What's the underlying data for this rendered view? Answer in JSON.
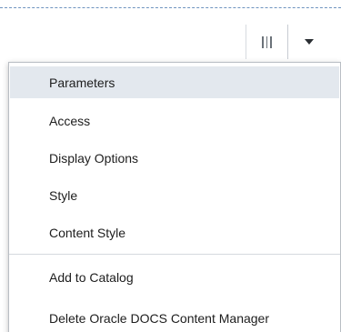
{
  "toolbar": {
    "columns_icon": "columns-icon",
    "dropdown_icon": "caret-down-icon"
  },
  "menu": {
    "items": [
      {
        "label": "Parameters",
        "highlighted": true
      },
      {
        "label": "Access"
      },
      {
        "label": "Display Options"
      },
      {
        "label": "Style"
      },
      {
        "label": "Content Style"
      },
      {
        "label": "Add to Catalog"
      },
      {
        "label": "Delete Oracle DOCS Content Manager"
      }
    ]
  },
  "colors": {
    "highlight": "#e3e8ee",
    "dashed_border": "#6f94bf",
    "menu_border": "#b9bec4"
  }
}
